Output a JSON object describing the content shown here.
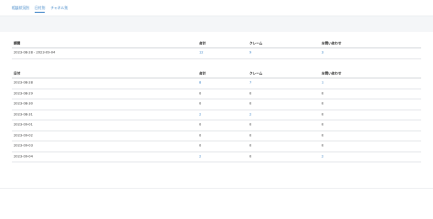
{
  "tabs": [
    {
      "label": "相談状況別"
    },
    {
      "label": "日付別"
    },
    {
      "label": "チャネル別"
    }
  ],
  "summary": {
    "headers": [
      "期間",
      "合計",
      "クレーム",
      "お問い合わせ"
    ],
    "row": {
      "period": "2023-08-28 - 2023-09-04",
      "total": "12",
      "claims": "9",
      "inquiries": "3"
    }
  },
  "daily": {
    "headers": [
      "日付",
      "合計",
      "クレーム",
      "お問い合わせ"
    ],
    "rows": [
      {
        "date": "2023-08-28",
        "total": "8",
        "claims": "7",
        "inquiries": "1"
      },
      {
        "date": "2023-08-29",
        "total": "0",
        "claims": "0",
        "inquiries": "0"
      },
      {
        "date": "2023-08-30",
        "total": "0",
        "claims": "0",
        "inquiries": "0"
      },
      {
        "date": "2023-08-31",
        "total": "2",
        "claims": "2",
        "inquiries": "0"
      },
      {
        "date": "2023-09-01",
        "total": "0",
        "claims": "0",
        "inquiries": "0"
      },
      {
        "date": "2023-09-02",
        "total": "0",
        "claims": "0",
        "inquiries": "0"
      },
      {
        "date": "2023-09-03",
        "total": "0",
        "claims": "0",
        "inquiries": "0"
      },
      {
        "date": "2023-09-04",
        "total": "2",
        "claims": "0",
        "inquiries": "2"
      }
    ]
  },
  "colors": {
    "link": "#3a82c6",
    "filter_band": "#f4f6f8"
  }
}
